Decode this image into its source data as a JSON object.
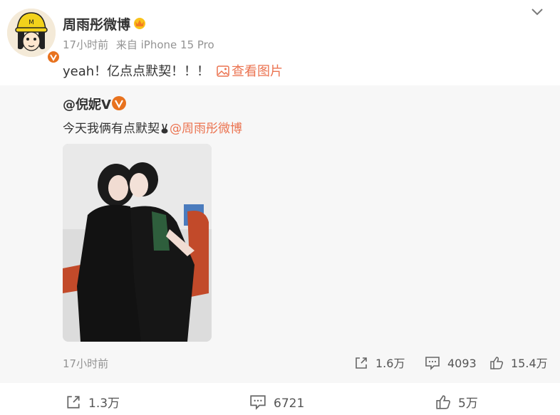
{
  "author": {
    "name": "周雨彤微博",
    "time": "17小时前",
    "source": "来自 iPhone 15 Pro"
  },
  "post": {
    "text": "yeah！亿点点默契！！！",
    "view_image_label": "查看图片"
  },
  "retweet": {
    "author": "@倪妮V",
    "text": "今天我俩有点默契",
    "mention": "@周雨彤微博",
    "time": "17小时前",
    "shares": "1.6万",
    "comments": "4093",
    "likes": "15.4万"
  },
  "footer": {
    "shares": "1.3万",
    "comments": "6721",
    "likes": "5万"
  },
  "colors": {
    "accent": "#eb7350",
    "badge": "#e8721e",
    "muted": "#939393",
    "retweet_bg": "#f7f7f7"
  }
}
